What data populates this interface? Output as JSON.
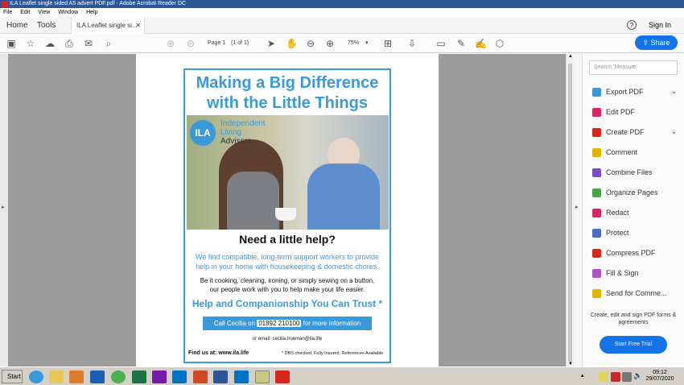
{
  "window": {
    "title": "ILA Leaflet single sided A5 advert PDF.pdf - Adobe Acrobat Reader DC"
  },
  "menu": [
    "File",
    "Edit",
    "View",
    "Window",
    "Help"
  ],
  "tabs": {
    "home": "Home",
    "tools": "Tools",
    "document": "ILA Leaflet single si..."
  },
  "header": {
    "help_icon": "?",
    "sign_in": "Sign In"
  },
  "toolbar": {
    "page_label": "Page 1",
    "page_count": "(1 of 1)",
    "zoom": "75%",
    "share": "Share"
  },
  "right_panel": {
    "search_placeholder": "Search 'Measure'",
    "tools": [
      {
        "label": "Export PDF",
        "color": "#3a9ad9"
      },
      {
        "label": "Edit PDF",
        "color": "#d9265f"
      },
      {
        "label": "Create PDF",
        "color": "#d9261c"
      },
      {
        "label": "Comment",
        "color": "#e0b400"
      },
      {
        "label": "Combine Files",
        "color": "#7a4ec4"
      },
      {
        "label": "Organize Pages",
        "color": "#4aa34a"
      },
      {
        "label": "Redact",
        "color": "#d9265f"
      },
      {
        "label": "Protect",
        "color": "#4a6bc4"
      },
      {
        "label": "Compress PDF",
        "color": "#d9261c"
      },
      {
        "label": "Fill & Sign",
        "color": "#a855c4"
      },
      {
        "label": "Send for Comme...",
        "color": "#e0b400"
      }
    ],
    "promo_text": "Create, edit and sign PDF forms & agreements",
    "trial_button": "Start Free Trial"
  },
  "leaflet": {
    "headline_1": "Making a Big Difference",
    "headline_2": "with the Little Things",
    "logo_letters": "ILA",
    "logo_line_1": "Independent",
    "logo_line_2": "Living",
    "logo_line_3": "Advisers",
    "question": "Need a little help?",
    "blue_1": "We find compatible, long-term support workers to provide",
    "blue_2": "help in your home with housekeeping & domestic chores.",
    "black_1": "Be it cooking, cleaning, ironing, or simply sewing on a button,",
    "black_2": "our people work with you to help make your life easier.",
    "trust": "Help and Companionship You Can Trust *",
    "call_pre": "Call Cecilia on ",
    "call_number": "01892 210100",
    "call_post": " for more information",
    "email": "or email: cecilia.trueman@ila.life",
    "find_us": "Find us at: www.ila.life",
    "dbs": "* DBS checked, Fully Insured, References Available"
  },
  "taskbar": {
    "start": "Start",
    "time": "09:12",
    "date": "29/07/2020"
  }
}
